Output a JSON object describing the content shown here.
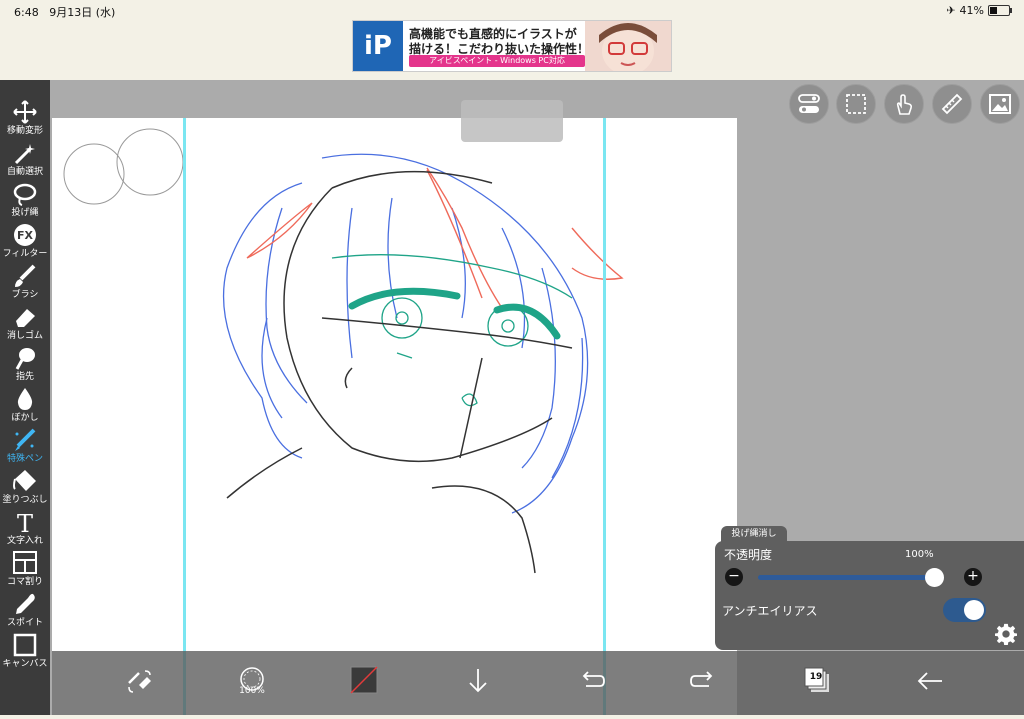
{
  "status_bar": {
    "time": "6:48",
    "date": "9月13日 (水)",
    "battery": "41%",
    "battery_level": 0.41
  },
  "ad": {
    "logo": "iP",
    "line1": "高機能でも直感的にイラストが",
    "line2": "描ける！こだわり抜いた操作性！",
    "line3": "アイビスペイント - Windows PC対応"
  },
  "tools": [
    {
      "label": "移動変形",
      "icon": "move-transform-icon"
    },
    {
      "label": "自動選択",
      "icon": "magic-wand-icon"
    },
    {
      "label": "投げ縄",
      "icon": "lasso-icon"
    },
    {
      "label": "フィルター",
      "icon": "fx-filter-icon"
    },
    {
      "label": "ブラシ",
      "icon": "brush-icon"
    },
    {
      "label": "消しゴム",
      "icon": "eraser-icon"
    },
    {
      "label": "指先",
      "icon": "finger-smudge-icon"
    },
    {
      "label": "ぼかし",
      "icon": "blur-drop-icon"
    },
    {
      "label": "特殊ペン",
      "icon": "special-pen-icon",
      "active": true
    },
    {
      "label": "塗りつぶし",
      "icon": "fill-bucket-icon"
    },
    {
      "label": "文字入れ",
      "icon": "text-icon"
    },
    {
      "label": "コマ割り",
      "icon": "frame-divider-icon"
    },
    {
      "label": "スポイト",
      "icon": "eyedropper-icon"
    },
    {
      "label": "キャンバス",
      "icon": "canvas-icon"
    }
  ],
  "tool_icon_fx": "FX",
  "tool_icon_text": "T",
  "top_buttons": [
    "toggle-settings-icon",
    "selection-icon",
    "gesture-hand-icon",
    "ruler-icon",
    "image-icon"
  ],
  "bottom_bar": {
    "brush_opacity": "100%",
    "layer_count": "19"
  },
  "lasso_panel": {
    "tab_label": "投げ縄消し",
    "opacity_label": "不透明度",
    "opacity_value": "100%",
    "opacity_fraction": 1.0,
    "minus_label": "−",
    "plus_label": "+",
    "antialias_label": "アンチエイリアス",
    "antialias_on": true
  },
  "colors": {
    "accent": "#3fb6f4",
    "toolbar_bg": "#3b3b3b",
    "workspace_bg": "#ababab",
    "guide_line": "#7ae6f1",
    "toggle_on": "#2d5a8f",
    "sketch_blue": "#4a6fe0",
    "sketch_red": "#ef6a5a",
    "sketch_green": "#1fa488",
    "sketch_black": "#333333"
  }
}
